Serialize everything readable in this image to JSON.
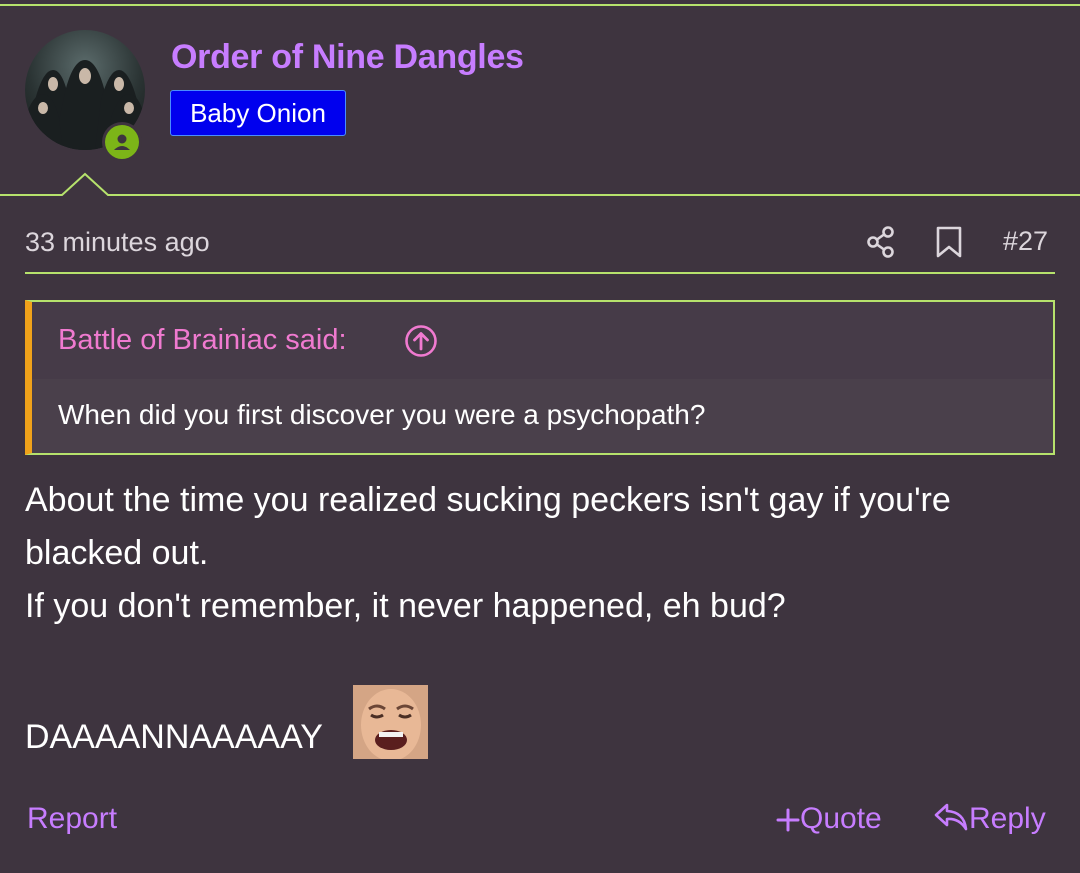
{
  "user": {
    "name": "Order of Nine Dangles",
    "badge": "Baby Onion",
    "avatar_icon": "hooded-figures-avatar",
    "status_icon": "online-user-icon",
    "status_color": "#7cb518"
  },
  "meta": {
    "time": "33 minutes ago",
    "post_number": "#27",
    "icons": [
      "share-icon",
      "bookmark-icon"
    ]
  },
  "quote": {
    "author": "Battle of Brainiac said:",
    "icon": "arrow-up-circle-icon",
    "text": "When did you first discover you were a psychopath?"
  },
  "body": {
    "lines": [
      "About the time you realized sucking peckers isn't gay if you're",
      "blacked out.",
      "If you don't remember, it never happened, eh bud?",
      "DAAAANNAAAAAY"
    ],
    "emoji": "crying-face-emoji"
  },
  "actions": {
    "report": "Report",
    "quote": "Quote",
    "reply": "Reply"
  },
  "colors": {
    "background": "#3e343f",
    "accent": "#b6e26c",
    "username": "#c77dff",
    "quote_author": "#f07ad0",
    "quote_border": "#f0a21a",
    "badge": "#0000ee"
  }
}
